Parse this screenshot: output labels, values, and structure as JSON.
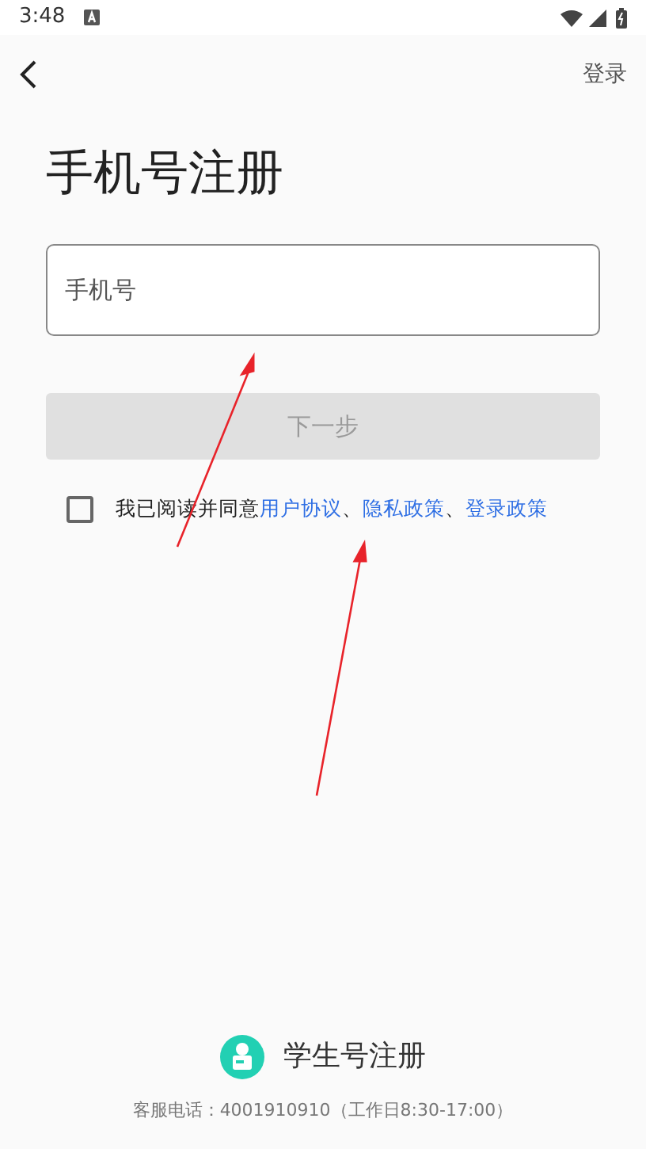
{
  "status_bar": {
    "time": "3:48"
  },
  "header": {
    "login_link": "登录"
  },
  "title": "手机号注册",
  "phone_field": {
    "placeholder": "手机号"
  },
  "next_button": {
    "label": "下一步",
    "disabled": true
  },
  "agreement": {
    "checked": false,
    "parts": [
      {
        "kind": "text",
        "text": "我已阅读并同意"
      },
      {
        "kind": "link",
        "text": "用户协议"
      },
      {
        "kind": "text",
        "text": "、"
      },
      {
        "kind": "link",
        "text": "隐私政策"
      },
      {
        "kind": "text",
        "text": "、"
      },
      {
        "kind": "link",
        "text": "登录政策"
      }
    ]
  },
  "student_register": {
    "label": "学生号注册"
  },
  "hotline": "客服电话：4001910910（工作日8:30-17:00）"
}
